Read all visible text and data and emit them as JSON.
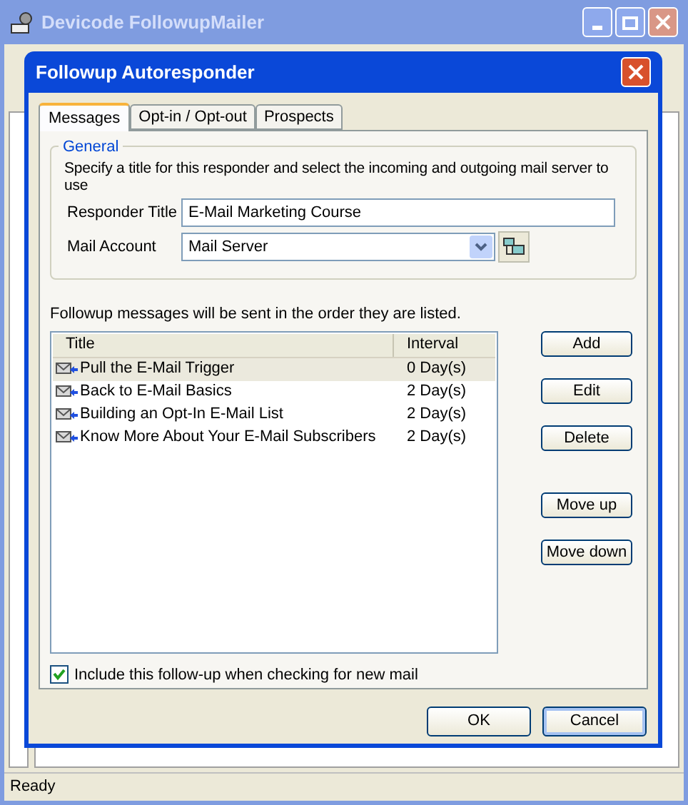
{
  "window": {
    "title": "Devicode FollowupMailer"
  },
  "dialog": {
    "title": "Followup Autoresponder",
    "tabs": [
      {
        "label": "Messages",
        "selected": true
      },
      {
        "label": "Opt-in / Opt-out",
        "selected": false
      },
      {
        "label": "Prospects",
        "selected": false
      }
    ],
    "general": {
      "legend": "General",
      "description": "Specify a title for this responder and select the incoming and outgoing mail server to use",
      "responder_title": {
        "label": "Responder Title",
        "value": "E-Mail Marketing Course"
      },
      "mail_account": {
        "label": "Mail Account",
        "value": "Mail Server"
      }
    },
    "list_caption": "Followup messages will be sent in the order they are listed.",
    "messages": {
      "columns": [
        "Title",
        "Interval"
      ],
      "rows": [
        {
          "title": "Pull the E-Mail Trigger",
          "interval": "0 Day(s)",
          "selected": true
        },
        {
          "title": "Back to E-Mail Basics",
          "interval": "2 Day(s)",
          "selected": false
        },
        {
          "title": "Building an Opt-In E-Mail List",
          "interval": "2 Day(s)",
          "selected": false
        },
        {
          "title": "Know More About Your E-Mail Subscribers",
          "interval": "2 Day(s)",
          "selected": false
        }
      ]
    },
    "side_buttons": [
      "Add",
      "Edit",
      "Delete",
      "Move up",
      "Move down"
    ],
    "include": {
      "label": "Include this follow-up when checking for new mail",
      "checked": true
    },
    "buttons": [
      {
        "label": "OK",
        "focused": false
      },
      {
        "label": "Cancel",
        "focused": true
      }
    ]
  },
  "status_bar": {
    "text": "Ready"
  }
}
